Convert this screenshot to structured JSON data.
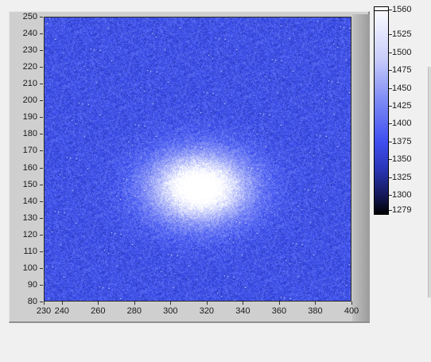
{
  "intensity_graph": {
    "x_ticks": [
      "230",
      "240",
      "260",
      "280",
      "300",
      "320",
      "340",
      "360",
      "380",
      "400"
    ],
    "y_ticks": [
      "250",
      "240",
      "230",
      "220",
      "210",
      "200",
      "190",
      "180",
      "170",
      "160",
      "150",
      "140",
      "130",
      "120",
      "110",
      "100",
      "90",
      "80"
    ],
    "x_range": [
      230,
      400
    ],
    "y_range": [
      80,
      250
    ],
    "colors": {
      "background": "#3b4ff0",
      "bright": "#e6e9ff",
      "dark": "#1a2280"
    }
  },
  "color_scale": {
    "ticks": [
      "1560",
      "1525",
      "1500",
      "1475",
      "1450",
      "1425",
      "1400",
      "1375",
      "1350",
      "1325",
      "1300",
      "1279"
    ],
    "range": [
      1279,
      1560
    ]
  }
}
